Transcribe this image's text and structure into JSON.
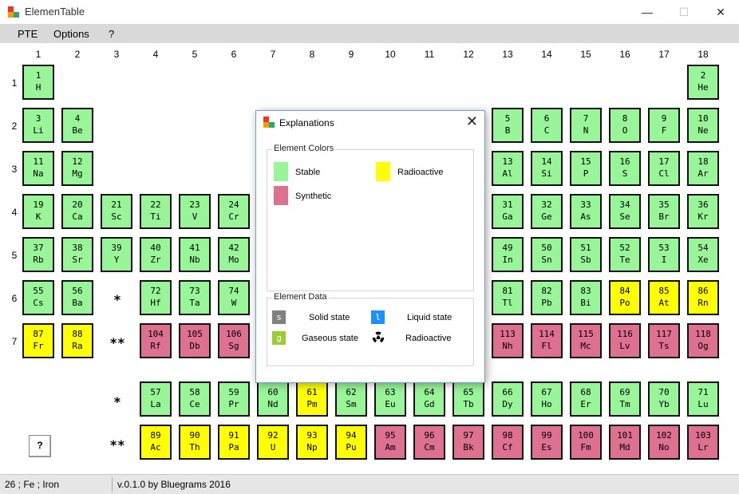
{
  "window": {
    "title": "ElemenTable",
    "minimize": "—",
    "maximize": "☐",
    "close": "✕"
  },
  "menu": [
    "PTE",
    "Options",
    "?"
  ],
  "columns": [
    "1",
    "2",
    "3",
    "4",
    "5",
    "6",
    "7",
    "8",
    "9",
    "10",
    "11",
    "12",
    "13",
    "14",
    "15",
    "16",
    "17",
    "18"
  ],
  "rows": [
    "1",
    "2",
    "3",
    "4",
    "5",
    "6",
    "7"
  ],
  "colors": {
    "stable": "#98f598",
    "radioactive": "#ffff00",
    "synthetic": "#de7090",
    "solid": "#808080",
    "liquid": "#1e90ff",
    "gas": "#9acd32"
  },
  "elements": [
    {
      "n": "1",
      "s": "H",
      "g": 1,
      "p": 1,
      "t": "stable"
    },
    {
      "n": "2",
      "s": "He",
      "g": 18,
      "p": 1,
      "t": "stable"
    },
    {
      "n": "3",
      "s": "Li",
      "g": 1,
      "p": 2,
      "t": "stable"
    },
    {
      "n": "4",
      "s": "Be",
      "g": 2,
      "p": 2,
      "t": "stable"
    },
    {
      "n": "5",
      "s": "B",
      "g": 13,
      "p": 2,
      "t": "stable"
    },
    {
      "n": "6",
      "s": "C",
      "g": 14,
      "p": 2,
      "t": "stable"
    },
    {
      "n": "7",
      "s": "N",
      "g": 15,
      "p": 2,
      "t": "stable"
    },
    {
      "n": "8",
      "s": "O",
      "g": 16,
      "p": 2,
      "t": "stable"
    },
    {
      "n": "9",
      "s": "F",
      "g": 17,
      "p": 2,
      "t": "stable"
    },
    {
      "n": "10",
      "s": "Ne",
      "g": 18,
      "p": 2,
      "t": "stable"
    },
    {
      "n": "11",
      "s": "Na",
      "g": 1,
      "p": 3,
      "t": "stable"
    },
    {
      "n": "12",
      "s": "Mg",
      "g": 2,
      "p": 3,
      "t": "stable"
    },
    {
      "n": "13",
      "s": "Al",
      "g": 13,
      "p": 3,
      "t": "stable"
    },
    {
      "n": "14",
      "s": "Si",
      "g": 14,
      "p": 3,
      "t": "stable"
    },
    {
      "n": "15",
      "s": "P",
      "g": 15,
      "p": 3,
      "t": "stable"
    },
    {
      "n": "16",
      "s": "S",
      "g": 16,
      "p": 3,
      "t": "stable"
    },
    {
      "n": "17",
      "s": "Cl",
      "g": 17,
      "p": 3,
      "t": "stable"
    },
    {
      "n": "18",
      "s": "Ar",
      "g": 18,
      "p": 3,
      "t": "stable"
    },
    {
      "n": "19",
      "s": "K",
      "g": 1,
      "p": 4,
      "t": "stable"
    },
    {
      "n": "20",
      "s": "Ca",
      "g": 2,
      "p": 4,
      "t": "stable"
    },
    {
      "n": "21",
      "s": "Sc",
      "g": 3,
      "p": 4,
      "t": "stable"
    },
    {
      "n": "22",
      "s": "Ti",
      "g": 4,
      "p": 4,
      "t": "stable"
    },
    {
      "n": "23",
      "s": "V",
      "g": 5,
      "p": 4,
      "t": "stable"
    },
    {
      "n": "24",
      "s": "Cr",
      "g": 6,
      "p": 4,
      "t": "stable"
    },
    {
      "n": "31",
      "s": "Ga",
      "g": 13,
      "p": 4,
      "t": "stable"
    },
    {
      "n": "32",
      "s": "Ge",
      "g": 14,
      "p": 4,
      "t": "stable"
    },
    {
      "n": "33",
      "s": "As",
      "g": 15,
      "p": 4,
      "t": "stable"
    },
    {
      "n": "34",
      "s": "Se",
      "g": 16,
      "p": 4,
      "t": "stable"
    },
    {
      "n": "35",
      "s": "Br",
      "g": 17,
      "p": 4,
      "t": "stable"
    },
    {
      "n": "36",
      "s": "Kr",
      "g": 18,
      "p": 4,
      "t": "stable"
    },
    {
      "n": "37",
      "s": "Rb",
      "g": 1,
      "p": 5,
      "t": "stable"
    },
    {
      "n": "38",
      "s": "Sr",
      "g": 2,
      "p": 5,
      "t": "stable"
    },
    {
      "n": "39",
      "s": "Y",
      "g": 3,
      "p": 5,
      "t": "stable"
    },
    {
      "n": "40",
      "s": "Zr",
      "g": 4,
      "p": 5,
      "t": "stable"
    },
    {
      "n": "41",
      "s": "Nb",
      "g": 5,
      "p": 5,
      "t": "stable"
    },
    {
      "n": "42",
      "s": "Mo",
      "g": 6,
      "p": 5,
      "t": "stable"
    },
    {
      "n": "49",
      "s": "In",
      "g": 13,
      "p": 5,
      "t": "stable"
    },
    {
      "n": "50",
      "s": "Sn",
      "g": 14,
      "p": 5,
      "t": "stable"
    },
    {
      "n": "51",
      "s": "Sb",
      "g": 15,
      "p": 5,
      "t": "stable"
    },
    {
      "n": "52",
      "s": "Te",
      "g": 16,
      "p": 5,
      "t": "stable"
    },
    {
      "n": "53",
      "s": "I",
      "g": 17,
      "p": 5,
      "t": "stable"
    },
    {
      "n": "54",
      "s": "Xe",
      "g": 18,
      "p": 5,
      "t": "stable"
    },
    {
      "n": "55",
      "s": "Cs",
      "g": 1,
      "p": 6,
      "t": "stable"
    },
    {
      "n": "56",
      "s": "Ba",
      "g": 2,
      "p": 6,
      "t": "stable"
    },
    {
      "n": "72",
      "s": "Hf",
      "g": 4,
      "p": 6,
      "t": "stable"
    },
    {
      "n": "73",
      "s": "Ta",
      "g": 5,
      "p": 6,
      "t": "stable"
    },
    {
      "n": "74",
      "s": "W",
      "g": 6,
      "p": 6,
      "t": "stable"
    },
    {
      "n": "81",
      "s": "Tl",
      "g": 13,
      "p": 6,
      "t": "stable"
    },
    {
      "n": "82",
      "s": "Pb",
      "g": 14,
      "p": 6,
      "t": "stable"
    },
    {
      "n": "83",
      "s": "Bi",
      "g": 15,
      "p": 6,
      "t": "stable"
    },
    {
      "n": "84",
      "s": "Po",
      "g": 16,
      "p": 6,
      "t": "radio"
    },
    {
      "n": "85",
      "s": "At",
      "g": 17,
      "p": 6,
      "t": "radio"
    },
    {
      "n": "86",
      "s": "Rn",
      "g": 18,
      "p": 6,
      "t": "radio"
    },
    {
      "n": "87",
      "s": "Fr",
      "g": 1,
      "p": 7,
      "t": "radio"
    },
    {
      "n": "88",
      "s": "Ra",
      "g": 2,
      "p": 7,
      "t": "radio"
    },
    {
      "n": "104",
      "s": "Rf",
      "g": 4,
      "p": 7,
      "t": "synth"
    },
    {
      "n": "105",
      "s": "Db",
      "g": 5,
      "p": 7,
      "t": "synth"
    },
    {
      "n": "106",
      "s": "Sg",
      "g": 6,
      "p": 7,
      "t": "synth"
    },
    {
      "n": "113",
      "s": "Nh",
      "g": 13,
      "p": 7,
      "t": "synth"
    },
    {
      "n": "114",
      "s": "Fl",
      "g": 14,
      "p": 7,
      "t": "synth"
    },
    {
      "n": "115",
      "s": "Mc",
      "g": 15,
      "p": 7,
      "t": "synth"
    },
    {
      "n": "116",
      "s": "Lv",
      "g": 16,
      "p": 7,
      "t": "synth"
    },
    {
      "n": "117",
      "s": "Ts",
      "g": 17,
      "p": 7,
      "t": "synth"
    },
    {
      "n": "118",
      "s": "Og",
      "g": 18,
      "p": 7,
      "t": "synth"
    },
    {
      "n": "57",
      "s": "La",
      "g": 4,
      "p": 9,
      "t": "stable"
    },
    {
      "n": "58",
      "s": "Ce",
      "g": 5,
      "p": 9,
      "t": "stable"
    },
    {
      "n": "59",
      "s": "Pr",
      "g": 6,
      "p": 9,
      "t": "stable"
    },
    {
      "n": "60",
      "s": "Nd",
      "g": 7,
      "p": 9,
      "t": "stable"
    },
    {
      "n": "61",
      "s": "Pm",
      "g": 8,
      "p": 9,
      "t": "radio"
    },
    {
      "n": "62",
      "s": "Sm",
      "g": 9,
      "p": 9,
      "t": "stable"
    },
    {
      "n": "63",
      "s": "Eu",
      "g": 10,
      "p": 9,
      "t": "stable"
    },
    {
      "n": "64",
      "s": "Gd",
      "g": 11,
      "p": 9,
      "t": "stable"
    },
    {
      "n": "65",
      "s": "Tb",
      "g": 12,
      "p": 9,
      "t": "stable"
    },
    {
      "n": "66",
      "s": "Dy",
      "g": 13,
      "p": 9,
      "t": "stable"
    },
    {
      "n": "67",
      "s": "Ho",
      "g": 14,
      "p": 9,
      "t": "stable"
    },
    {
      "n": "68",
      "s": "Er",
      "g": 15,
      "p": 9,
      "t": "stable"
    },
    {
      "n": "69",
      "s": "Tm",
      "g": 16,
      "p": 9,
      "t": "stable"
    },
    {
      "n": "70",
      "s": "Yb",
      "g": 17,
      "p": 9,
      "t": "stable"
    },
    {
      "n": "71",
      "s": "Lu",
      "g": 18,
      "p": 9,
      "t": "stable"
    },
    {
      "n": "89",
      "s": "Ac",
      "g": 4,
      "p": 10,
      "t": "radio"
    },
    {
      "n": "90",
      "s": "Th",
      "g": 5,
      "p": 10,
      "t": "radio"
    },
    {
      "n": "91",
      "s": "Pa",
      "g": 6,
      "p": 10,
      "t": "radio"
    },
    {
      "n": "92",
      "s": "U",
      "g": 7,
      "p": 10,
      "t": "radio"
    },
    {
      "n": "93",
      "s": "Np",
      "g": 8,
      "p": 10,
      "t": "radio"
    },
    {
      "n": "94",
      "s": "Pu",
      "g": 9,
      "p": 10,
      "t": "radio"
    },
    {
      "n": "95",
      "s": "Am",
      "g": 10,
      "p": 10,
      "t": "synth"
    },
    {
      "n": "96",
      "s": "Cm",
      "g": 11,
      "p": 10,
      "t": "synth"
    },
    {
      "n": "97",
      "s": "Bk",
      "g": 12,
      "p": 10,
      "t": "synth"
    },
    {
      "n": "98",
      "s": "Cf",
      "g": 13,
      "p": 10,
      "t": "synth"
    },
    {
      "n": "99",
      "s": "Es",
      "g": 14,
      "p": 10,
      "t": "synth"
    },
    {
      "n": "100",
      "s": "Fm",
      "g": 15,
      "p": 10,
      "t": "synth"
    },
    {
      "n": "101",
      "s": "Md",
      "g": 16,
      "p": 10,
      "t": "synth"
    },
    {
      "n": "102",
      "s": "No",
      "g": 17,
      "p": 10,
      "t": "synth"
    },
    {
      "n": "103",
      "s": "Lr",
      "g": 18,
      "p": 10,
      "t": "synth"
    }
  ],
  "markers": {
    "lanthanide": "*",
    "actinide": "**"
  },
  "help_button": "?",
  "status": {
    "left": "26 ; Fe ; Iron",
    "right": "v.0.1.0 by Bluegrams 2016"
  },
  "dialog": {
    "title": "Explanations",
    "close": "✕",
    "colors_group": "Element Colors",
    "stable": "Stable",
    "radioactive": "Radioactive",
    "synthetic": "Synthetic",
    "data_group": "Element Data",
    "solid_symbol": "s",
    "solid": "Solid state",
    "liquid_symbol": "l",
    "liquid": "Liquid state",
    "gas_symbol": "g",
    "gas": "Gaseous state",
    "radio_label": "Radioactive",
    "radio_icon": "radiation-icon"
  }
}
